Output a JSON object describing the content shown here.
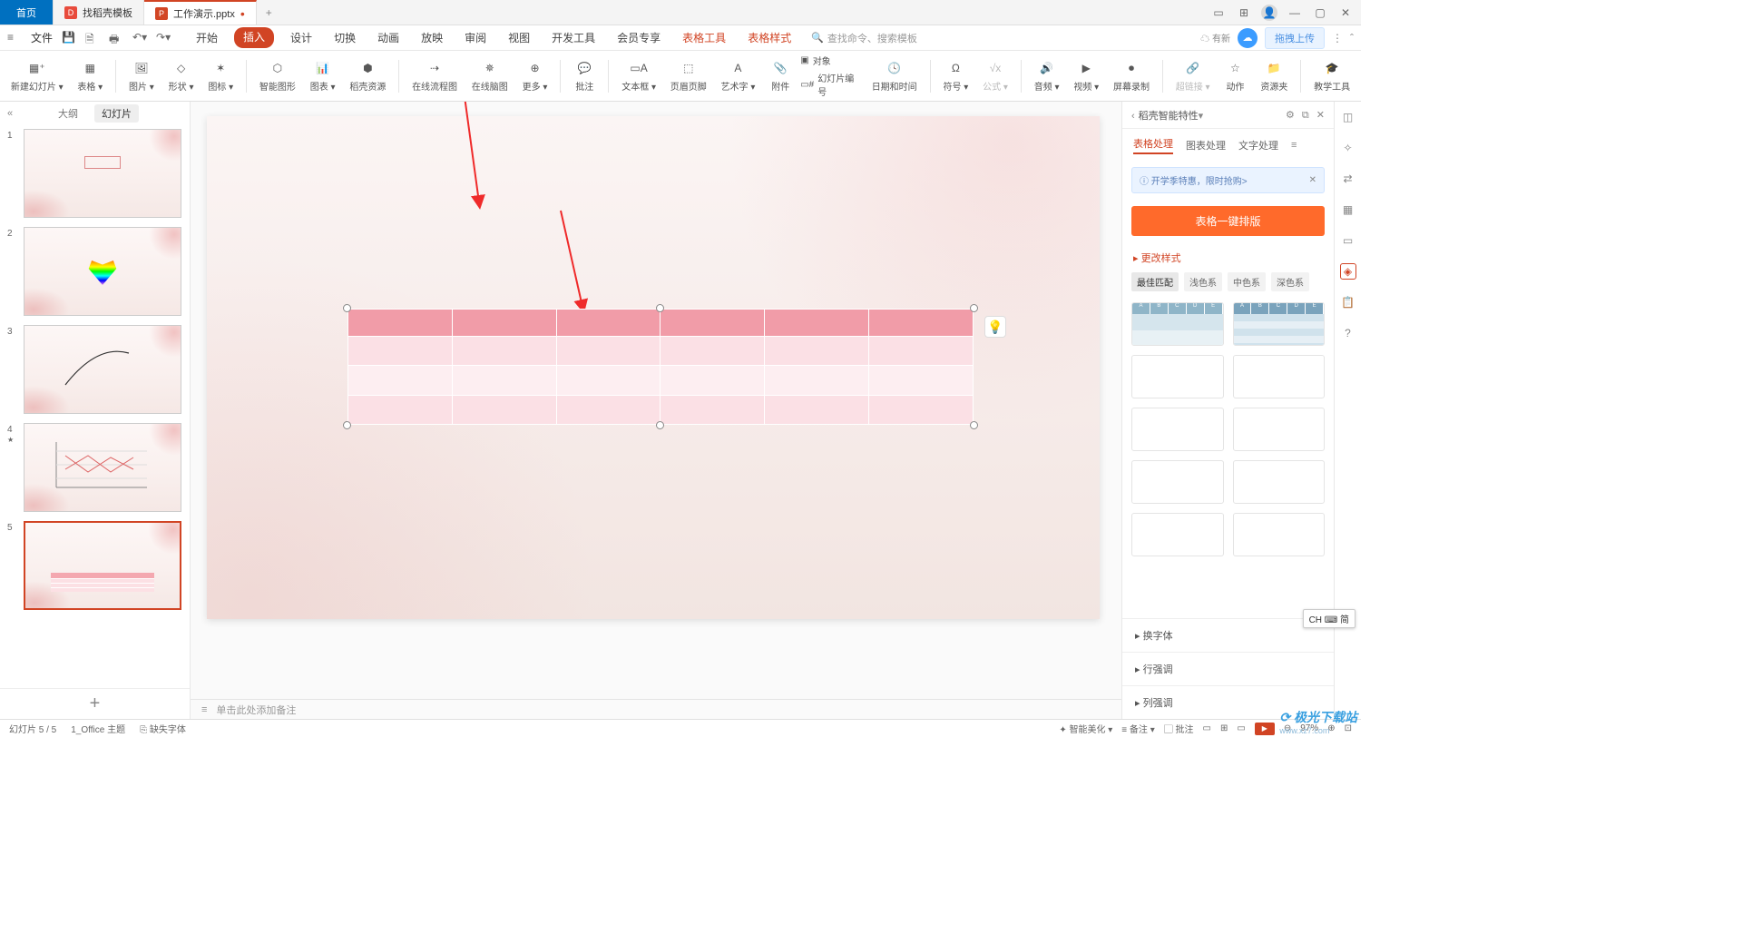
{
  "titlebar": {
    "home_tab": "首页",
    "tab2": "找稻壳模板",
    "tab3": "工作演示.pptx"
  },
  "menubar": {
    "file": "文件",
    "tabs": [
      "开始",
      "插入",
      "设计",
      "切换",
      "动画",
      "放映",
      "审阅",
      "视图",
      "开发工具",
      "会员专享"
    ],
    "context_tabs": [
      "表格工具",
      "表格样式"
    ],
    "active_tab_index": 1,
    "search_placeholder": "查找命令、搜索模板",
    "upload_label": "拖拽上传",
    "new_fn": "有新"
  },
  "ribbon": [
    {
      "label": "新建幻灯片",
      "dd": true
    },
    {
      "label": "表格",
      "dd": true
    },
    {
      "sep": true
    },
    {
      "label": "图片",
      "dd": true
    },
    {
      "label": "形状",
      "dd": true
    },
    {
      "label": "图标",
      "dd": true
    },
    {
      "sep": true
    },
    {
      "label": "智能图形"
    },
    {
      "label": "图表",
      "dd": true
    },
    {
      "label": "稻壳资源"
    },
    {
      "sep": true
    },
    {
      "label": "在线流程图"
    },
    {
      "label": "在线脑图"
    },
    {
      "label": "更多",
      "dd": true
    },
    {
      "sep": true
    },
    {
      "label": "批注"
    },
    {
      "sep": true
    },
    {
      "label": "文本框",
      "dd": true
    },
    {
      "label": "页眉页脚"
    },
    {
      "label": "艺术字",
      "dd": true
    },
    {
      "label": "附件"
    },
    {
      "label": "对象"
    },
    {
      "label": "幻灯片编号"
    },
    {
      "label": "日期和时间"
    },
    {
      "sep": true
    },
    {
      "label": "符号",
      "dd": true
    },
    {
      "label": "公式",
      "dd": true
    },
    {
      "sep": true
    },
    {
      "label": "音频",
      "dd": true
    },
    {
      "label": "视频",
      "dd": true
    },
    {
      "label": "屏幕录制"
    },
    {
      "sep": true
    },
    {
      "label": "超链接",
      "dd": true
    },
    {
      "label": "动作"
    },
    {
      "label": "资源夹"
    },
    {
      "sep": true
    },
    {
      "label": "教学工具"
    }
  ],
  "ribbon_icons_row": [
    "对象",
    "幻灯片编号"
  ],
  "thumbs": {
    "tab_outline": "大纲",
    "tab_slides": "幻灯片",
    "count": 5,
    "selected": 5,
    "star_on": 4
  },
  "notes": {
    "placeholder": "单击此处添加备注"
  },
  "rpanel": {
    "title": "稻壳智能特性",
    "tabs": [
      "表格处理",
      "图表处理",
      "文字处理"
    ],
    "banner": "开学季特惠，限时抢购>",
    "button": "表格一键排版",
    "section": "更改样式",
    "filters": [
      "最佳匹配",
      "浅色系",
      "中色系",
      "深色系"
    ],
    "collapsers": [
      "换字体",
      "行强调",
      "列强调"
    ]
  },
  "status": {
    "slide": "幻灯片 5 / 5",
    "theme": "1_Office 主题",
    "font_warn": "缺失字体",
    "beautify": "智能美化",
    "notes": "备注 ▾",
    "comments": "批注",
    "zoom": "97%"
  },
  "ime": "CH ⌨ 简",
  "watermark": {
    "main": "极光下载站",
    "sub": "www.xz7.com"
  }
}
